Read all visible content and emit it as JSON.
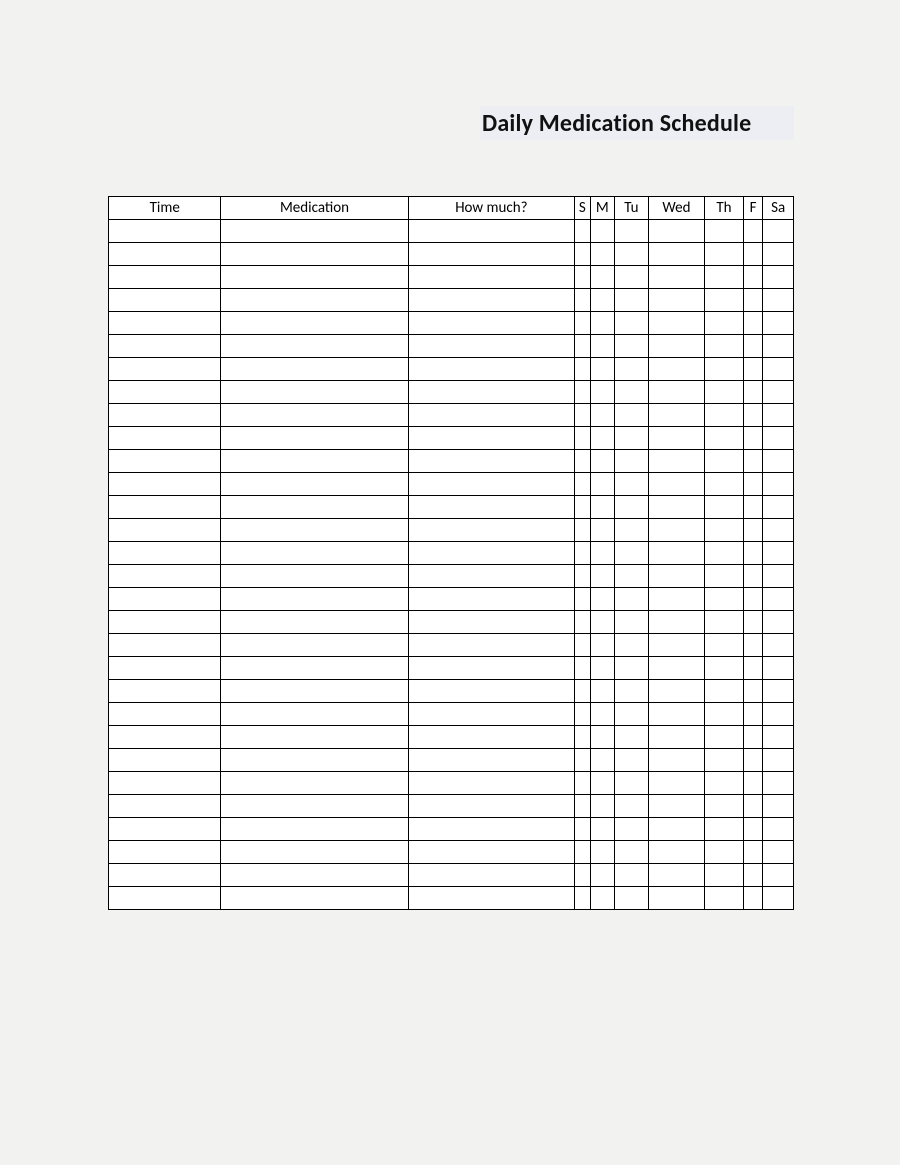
{
  "title": "Daily Medication Schedule",
  "columns": [
    "Time",
    "Medication",
    "How much?",
    "S",
    "M",
    "Tu",
    "Wed",
    "Th",
    "F",
    "Sa"
  ],
  "rowCount": 30
}
